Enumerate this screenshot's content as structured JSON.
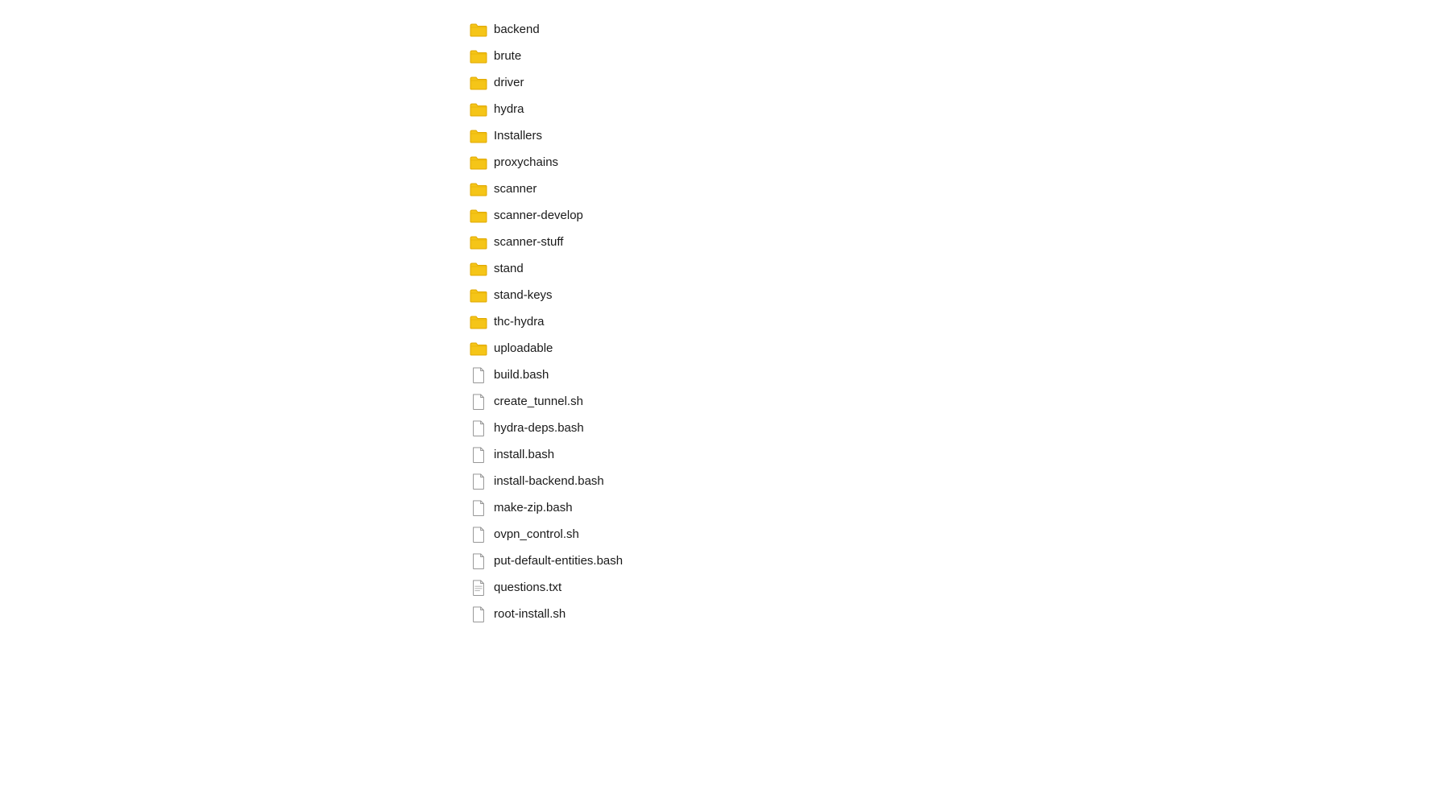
{
  "fileList": {
    "items": [
      {
        "name": "backend",
        "type": "folder"
      },
      {
        "name": "brute",
        "type": "folder"
      },
      {
        "name": "driver",
        "type": "folder"
      },
      {
        "name": "hydra",
        "type": "folder"
      },
      {
        "name": "Installers",
        "type": "folder"
      },
      {
        "name": "proxychains",
        "type": "folder"
      },
      {
        "name": "scanner",
        "type": "folder"
      },
      {
        "name": "scanner-develop",
        "type": "folder"
      },
      {
        "name": "scanner-stuff",
        "type": "folder"
      },
      {
        "name": "stand",
        "type": "folder"
      },
      {
        "name": "stand-keys",
        "type": "folder"
      },
      {
        "name": "thc-hydra",
        "type": "folder"
      },
      {
        "name": "uploadable",
        "type": "folder"
      },
      {
        "name": "build.bash",
        "type": "file"
      },
      {
        "name": "create_tunnel.sh",
        "type": "file"
      },
      {
        "name": "hydra-deps.bash",
        "type": "file"
      },
      {
        "name": "install.bash",
        "type": "file"
      },
      {
        "name": "install-backend.bash",
        "type": "file"
      },
      {
        "name": "make-zip.bash",
        "type": "file"
      },
      {
        "name": "ovpn_control.sh",
        "type": "file"
      },
      {
        "name": "put-default-entities.bash",
        "type": "file"
      },
      {
        "name": "questions.txt",
        "type": "file-text"
      },
      {
        "name": "root-install.sh",
        "type": "file"
      }
    ]
  },
  "colors": {
    "folderFill": "#F5C518",
    "folderStroke": "#E0A800",
    "fileStroke": "#888888",
    "fileLineStroke": "#aaaaaa",
    "textColor": "#1a1a1a"
  }
}
